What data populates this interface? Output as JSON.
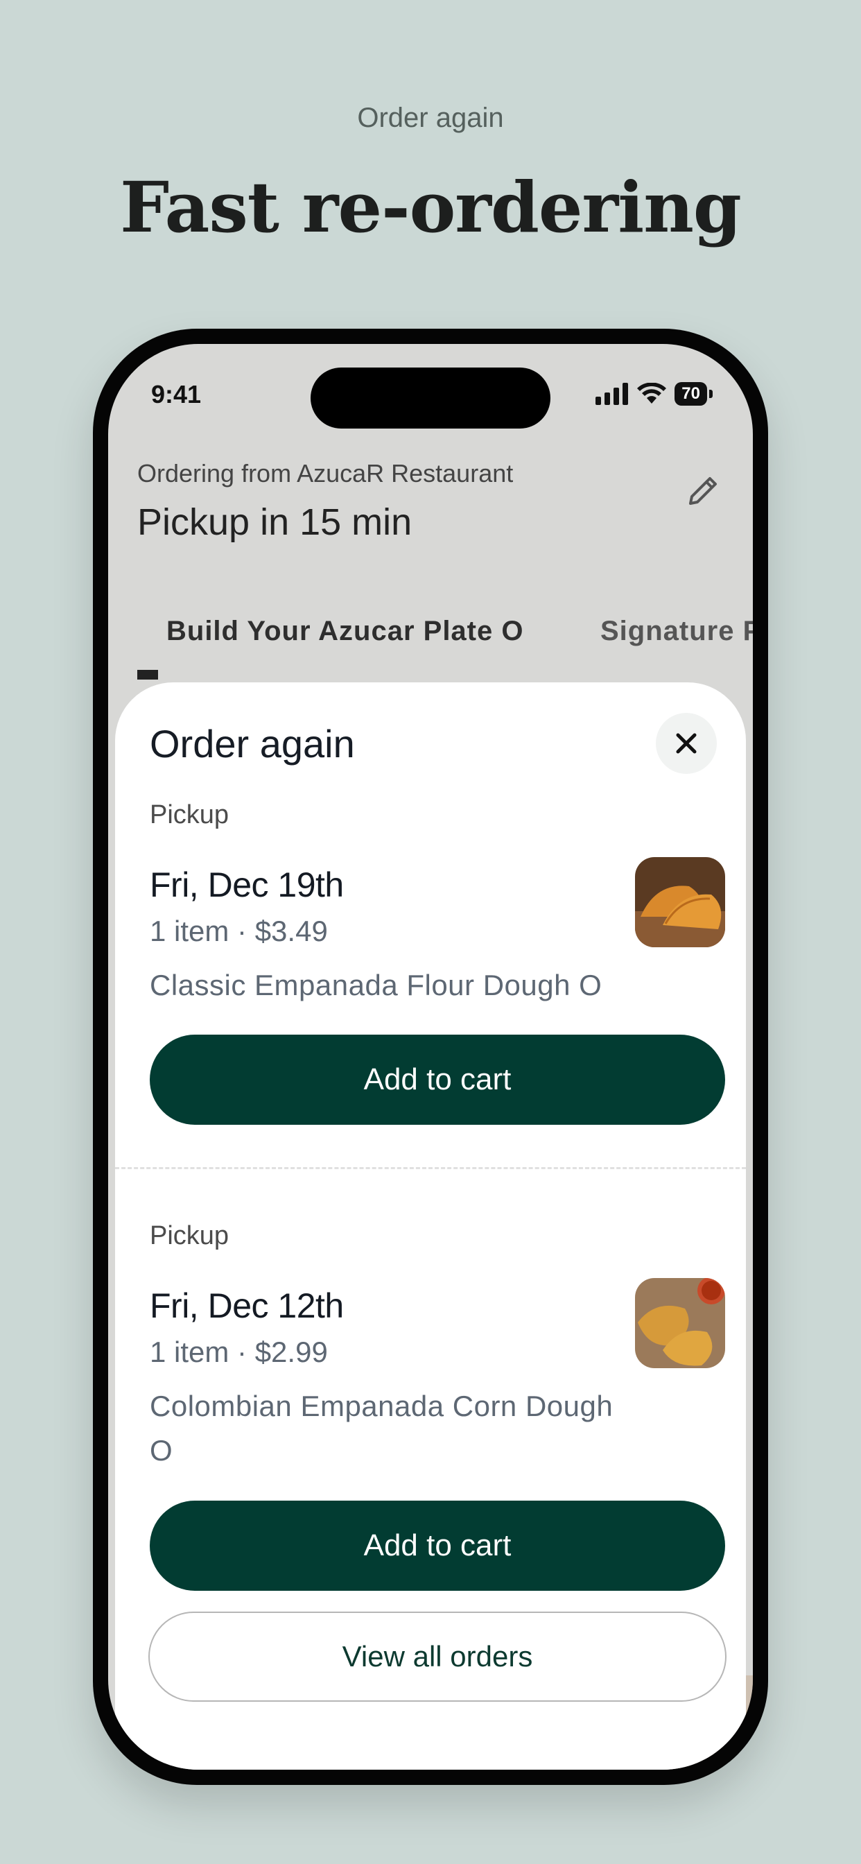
{
  "promo": {
    "eyebrow": "Order again",
    "headline": "Fast re-ordering"
  },
  "status_bar": {
    "time": "9:41",
    "battery": "70",
    "icons": [
      "cellular-signal-icon",
      "wifi-icon",
      "battery-icon"
    ]
  },
  "background": {
    "ordering_from": "Ordering from AzucaR Restaurant",
    "pickup_time": "Pickup in 15 min",
    "edit_icon": "pencil-icon",
    "tabs": [
      {
        "label": "Build Your Azucar Plate O"
      },
      {
        "label": "Signature P"
      }
    ]
  },
  "sheet": {
    "title": "Order again",
    "close_icon": "close-icon",
    "orders": [
      {
        "type": "Pickup",
        "date": "Fri, Dec 19th",
        "meta": "1 item · $3.49",
        "item": "Classic Empanada Flour Dough O",
        "thumb": "empanada-image",
        "button": "Add to cart"
      },
      {
        "type": "Pickup",
        "date": "Fri, Dec 12th",
        "meta": "1 item · $2.99",
        "item": "Colombian Empanada Corn Dough O",
        "thumb": "empanada-image",
        "button": "Add to cart"
      }
    ],
    "view_all": "View all orders"
  },
  "colors": {
    "page_bg": "#cbd8d5",
    "primary_button": "#023c32",
    "secondary_text": "#0d3a30"
  }
}
